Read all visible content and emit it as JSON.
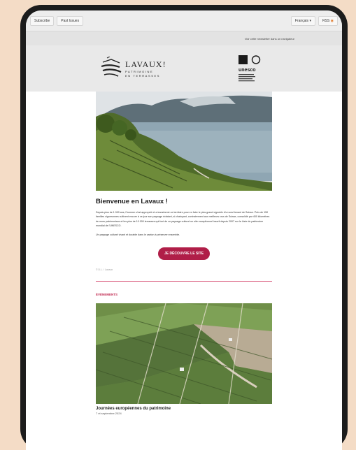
{
  "toolbar": {
    "subscribe_label": "Subscribe",
    "past_issues_label": "Past Issues",
    "language_label": "Français",
    "rss_label": "RSS"
  },
  "preheader": {
    "text": "Voir cette newsletter dans un navigateur"
  },
  "header": {
    "logo_name": "LAVAUX!",
    "logo_line1": "PATRIMOINE",
    "logo_line2": "EN TERRASSES",
    "unesco_label": "unesco"
  },
  "main": {
    "title": "Bienvenue en Lavaux !",
    "paragraph1": "Depuis plus de 1 000 ans, l'homme s'est approprié et a transformé ce territoire pour en faire le plus grand vignoble d'un seul tenant de Suisse. Près de 150 familles vigneronnes cultivent encore à ce jour son paysage éclatant, si chatoyant, contrairement aux meilleurs crus de Suisse, consolidé par 400 kilomètres de murs patrimoniaux et les plus de 10 000 terrasses qui font de ce paysage culturel un site exceptionnel inscrit depuis 2007 sur la Liste du patrimoine mondial de l'UNESCO.",
    "paragraph2": "Un paysage culturel vivant et durable dans le canton à préserver ensemble.",
    "cta_label": "JE DÉCOUVRE LE SITE",
    "photo_credit": "© D.L. / Lavaux"
  },
  "events": {
    "section_label": "ÉVÉNEMENTS",
    "item_title": "Journées européennes du patrimoine",
    "item_date": "7 et septembre 2024"
  },
  "colors": {
    "accent": "#b01e48",
    "page_bg": "#f4dcc6",
    "device_frame": "#1c1c1c"
  }
}
